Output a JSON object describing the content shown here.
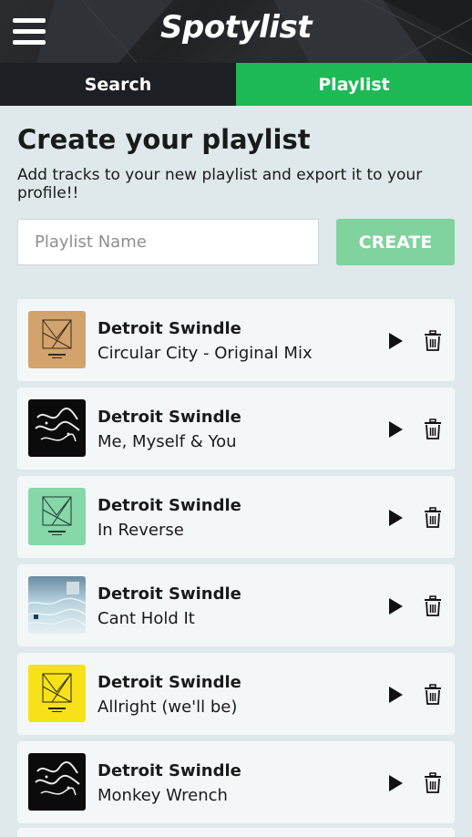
{
  "header": {
    "brand": "Spotylist",
    "menu_icon": "hamburger-menu-icon"
  },
  "tabs": [
    {
      "label": "Search",
      "active": false
    },
    {
      "label": "Playlist",
      "active": true
    }
  ],
  "main": {
    "title": "Create your playlist",
    "subtitle": "Add tracks to your new playlist and export it to your profile!!",
    "playlist_name": {
      "placeholder": "Playlist Name",
      "value": ""
    },
    "create_label": "CREATE"
  },
  "tracks": [
    {
      "artist": "Detroit Swindle",
      "title": "Circular City - Original Mix",
      "cover": "tan-geometric"
    },
    {
      "artist": "Detroit Swindle",
      "title": "Me, Myself & You",
      "cover": "black-script"
    },
    {
      "artist": "Detroit Swindle",
      "title": "In Reverse",
      "cover": "green-geometric"
    },
    {
      "artist": "Detroit Swindle",
      "title": "Cant Hold It",
      "cover": "water-photo"
    },
    {
      "artist": "Detroit Swindle",
      "title": "Allright (we'll be)",
      "cover": "yellow-geometric"
    },
    {
      "artist": "Detroit Swindle",
      "title": "Monkey Wrench",
      "cover": "black-script"
    }
  ],
  "colors": {
    "accent": "#1db954",
    "create_button": "#80d39d",
    "header_bg": "#25272b",
    "tab_inactive": "#1c1f24",
    "page_bg": "#dfe8eb",
    "card_bg": "#f4f7f8"
  }
}
